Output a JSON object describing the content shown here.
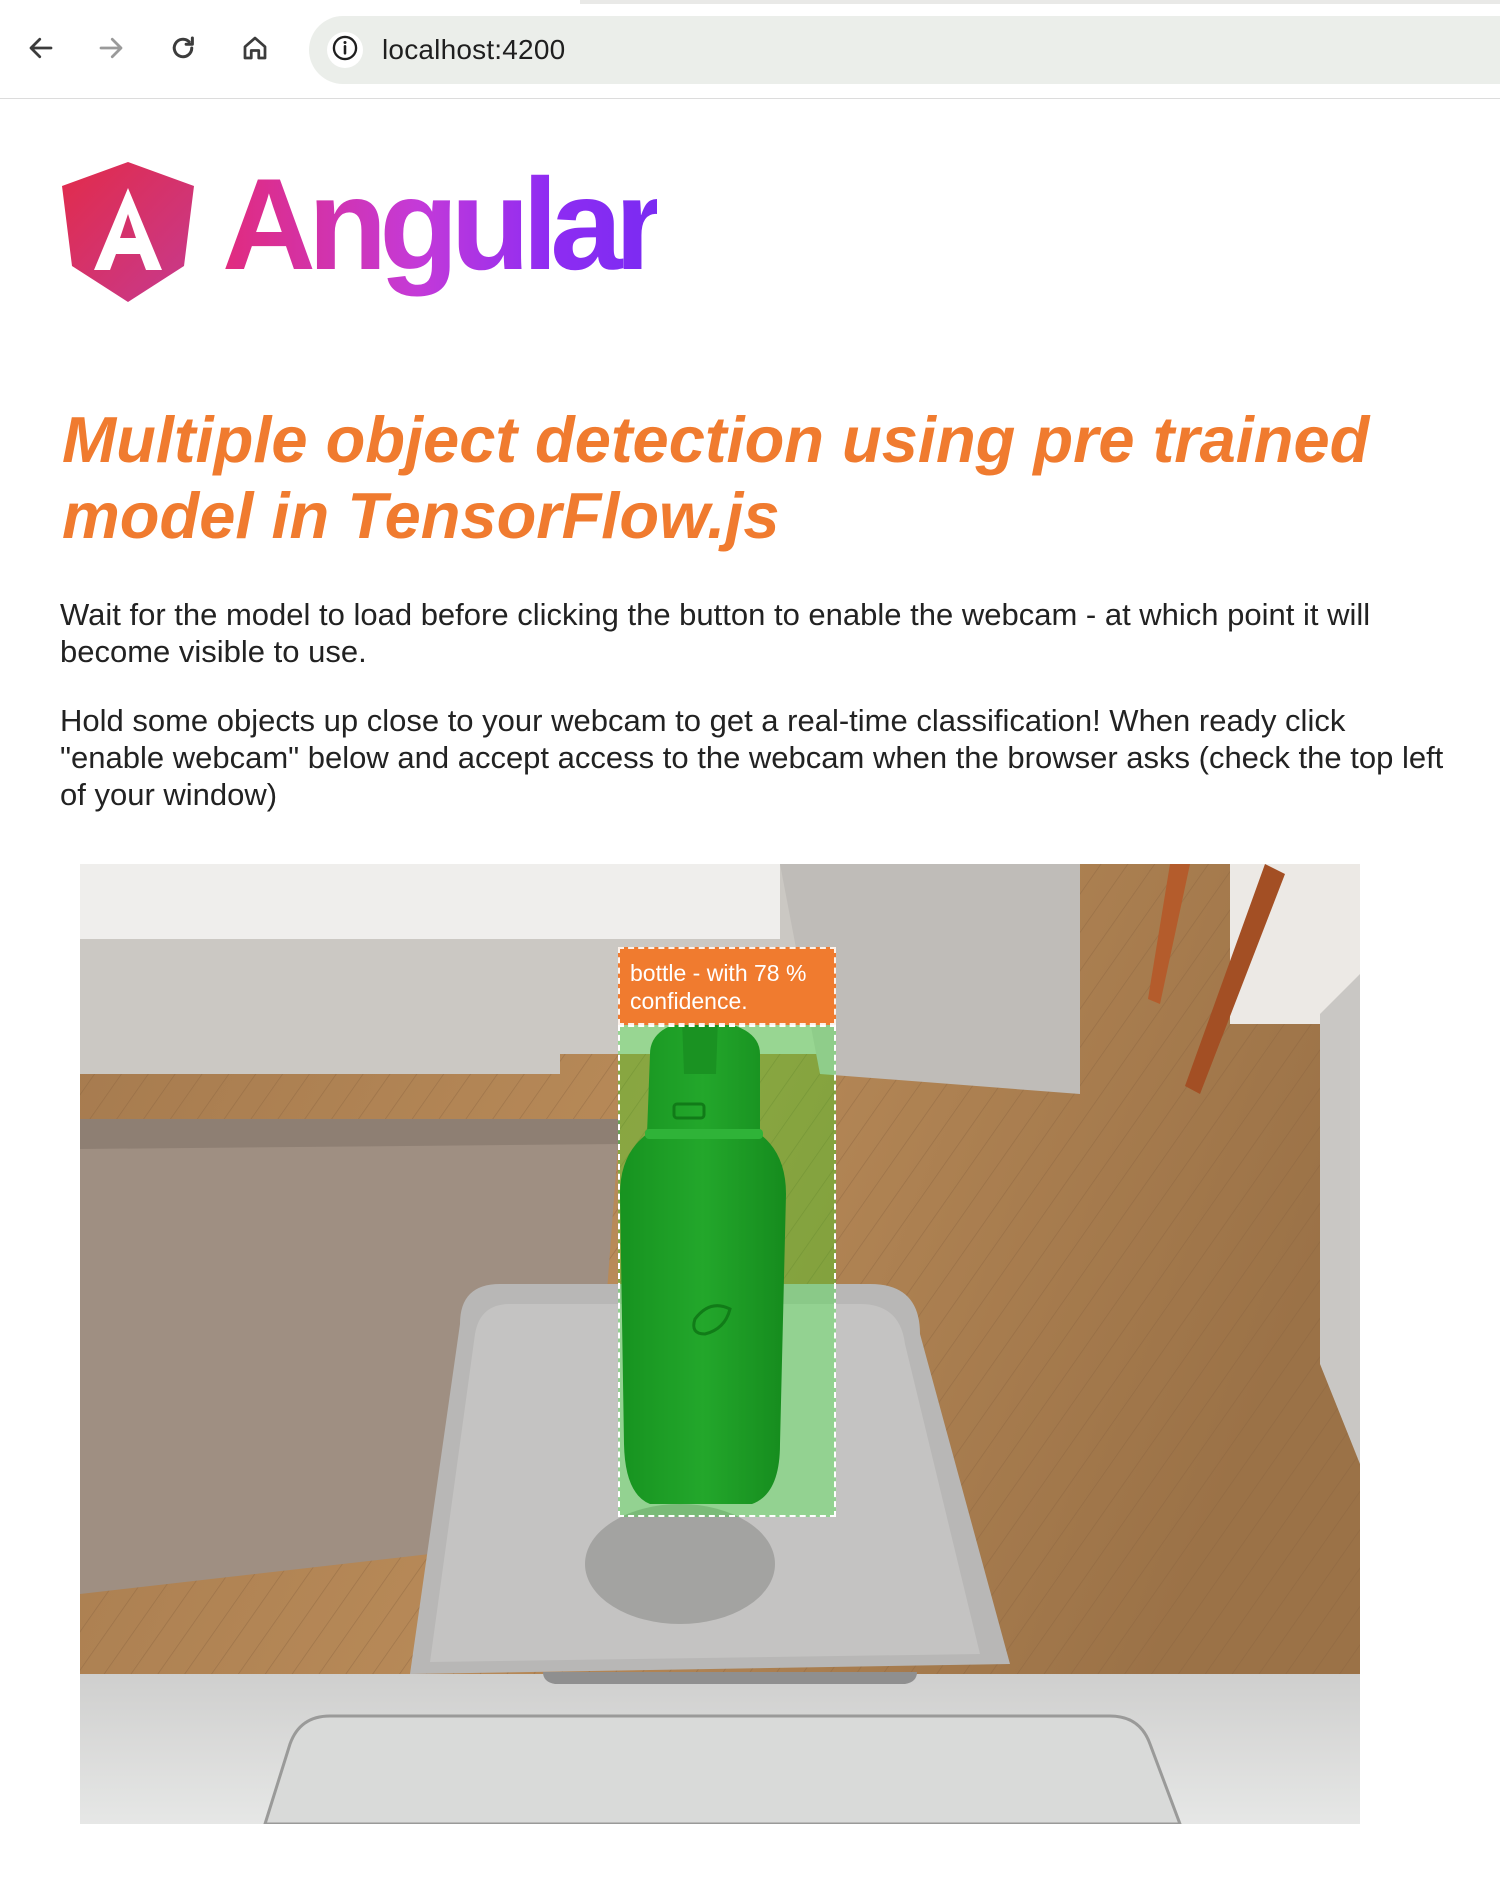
{
  "browser": {
    "url": "localhost:4200",
    "icons": [
      "back-arrow-icon",
      "forward-arrow-icon",
      "reload-icon",
      "home-icon",
      "site-info-icon"
    ]
  },
  "logo": {
    "wordmark": "Angular",
    "colors": {
      "shield_start": "#e22b4a",
      "shield_end": "#c63a8f",
      "text_start": "#e12b7d",
      "text_end": "#7a2bf2"
    }
  },
  "page": {
    "title": "Multiple object detection using pre trained model in TensorFlow.js",
    "intro": "Wait for the model to load before clicking the button to enable the webcam - at which point it will become visible to use.",
    "instructions": "Hold some objects up close to your webcam to get a real-time classification! When ready click \"enable webcam\" below and accept access to the webcam when the browser asks (check the top left of your window)"
  },
  "detection": {
    "label": "bottle - with 78 % confidence.",
    "class": "bottle",
    "confidence_percent": 78,
    "colors": {
      "label_bg": "#f07b2f",
      "highlighter": "rgba(0,255,0,0.25)"
    }
  },
  "colors": {
    "title": "#f07b2f",
    "body_text": "#222222"
  }
}
